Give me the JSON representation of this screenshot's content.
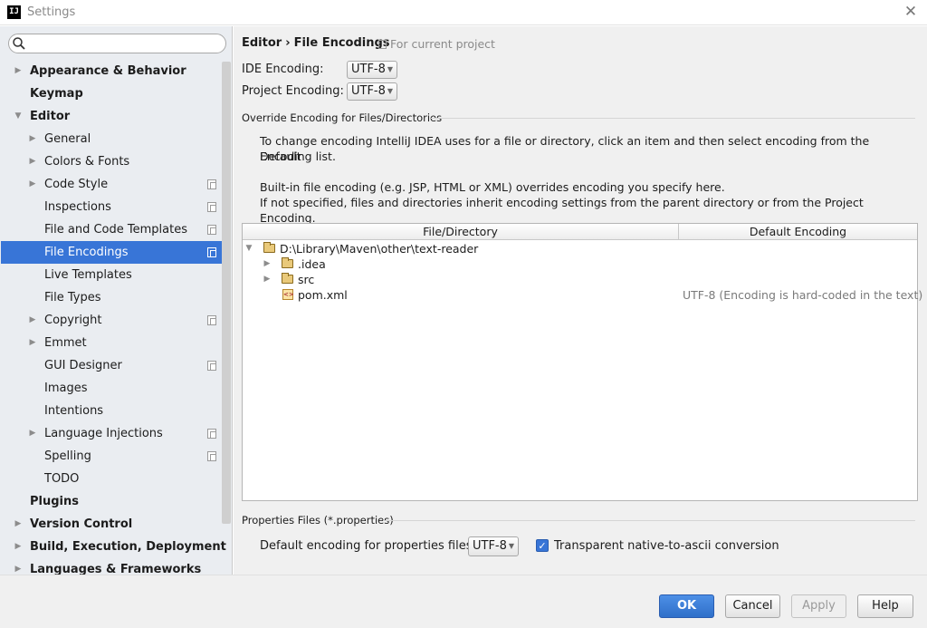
{
  "window": {
    "title": "Settings",
    "app_icon": "IJ"
  },
  "search": {
    "value": "",
    "placeholder": ""
  },
  "sidebar": {
    "items": [
      {
        "label": "Appearance & Behavior",
        "arrow": "▶"
      },
      {
        "label": "Keymap",
        "arrow": ""
      },
      {
        "label": "Editor",
        "arrow": "▼"
      },
      {
        "label": "General",
        "arrow": "▶"
      },
      {
        "label": "Colors & Fonts",
        "arrow": "▶"
      },
      {
        "label": "Code Style",
        "arrow": "▶"
      },
      {
        "label": "Inspections",
        "arrow": ""
      },
      {
        "label": "File and Code Templates",
        "arrow": ""
      },
      {
        "label": "File Encodings",
        "arrow": ""
      },
      {
        "label": "Live Templates",
        "arrow": ""
      },
      {
        "label": "File Types",
        "arrow": ""
      },
      {
        "label": "Copyright",
        "arrow": "▶"
      },
      {
        "label": "Emmet",
        "arrow": "▶"
      },
      {
        "label": "GUI Designer",
        "arrow": ""
      },
      {
        "label": "Images",
        "arrow": ""
      },
      {
        "label": "Intentions",
        "arrow": ""
      },
      {
        "label": "Language Injections",
        "arrow": "▶"
      },
      {
        "label": "Spelling",
        "arrow": ""
      },
      {
        "label": "TODO",
        "arrow": ""
      },
      {
        "label": "Plugins",
        "arrow": ""
      },
      {
        "label": "Version Control",
        "arrow": "▶"
      },
      {
        "label": "Build, Execution, Deployment",
        "arrow": "▶"
      },
      {
        "label": "Languages & Frameworks",
        "arrow": "▶"
      }
    ],
    "selected_label": "File Encodings"
  },
  "breadcrumb": {
    "parent": "Editor",
    "separator": "›",
    "current": "File Encodings",
    "note": "For current project"
  },
  "encodings": {
    "ide_label": "IDE Encoding:",
    "ide_value": "UTF-8",
    "project_label": "Project Encoding:",
    "project_value": "UTF-8"
  },
  "override": {
    "title": "Override Encoding for Files/Directories",
    "desc1_line1": "To change encoding IntelliJ IDEA uses for a file or directory, click an item and then select encoding from the Default",
    "desc1_line2": "Encoding list.",
    "desc2_line1": "Built-in file encoding (e.g. JSP, HTML or XML) overrides encoding you specify here.",
    "desc2_line2": "If not specified, files and directories inherit encoding settings from the parent directory or from the Project Encoding.",
    "columns": [
      "File/Directory",
      "Default Encoding"
    ],
    "rows": [
      {
        "name": "D:\\Library\\Maven\\other\\text-reader",
        "arrow": "▼",
        "encoding": ""
      },
      {
        "name": ".idea",
        "arrow": "▶",
        "encoding": ""
      },
      {
        "name": "src",
        "arrow": "▶",
        "encoding": ""
      },
      {
        "name": "pom.xml",
        "arrow": "",
        "encoding": "UTF-8 (Encoding is hard-coded in the text)"
      }
    ]
  },
  "properties": {
    "title": "Properties Files (*.properties)",
    "default_label": "Default encoding for properties files:",
    "default_value": "UTF-8",
    "transparent_label": "Transparent native-to-ascii conversion",
    "transparent_checked": true
  },
  "buttons": {
    "ok": "OK",
    "cancel": "Cancel",
    "apply": "Apply",
    "help": "Help"
  },
  "colors": {
    "selection": "#3875d7",
    "sidebar_bg": "#eaedf1",
    "panel_bg": "#f0f0f0"
  }
}
